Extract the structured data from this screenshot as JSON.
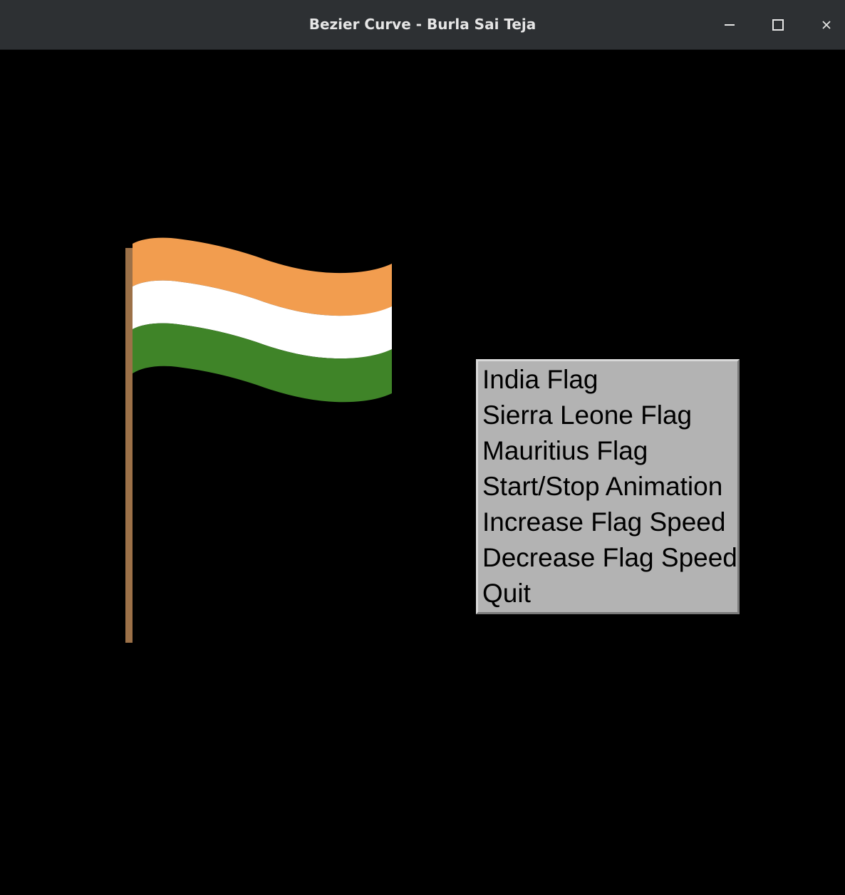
{
  "window": {
    "title": "Bezier Curve - Burla Sai Teja",
    "controls": {
      "minimize_icon": "minimize-icon",
      "maximize_icon": "maximize-icon",
      "close_icon": "close-icon"
    }
  },
  "scene": {
    "current_flag": "India",
    "pole_color": "#9c7148",
    "stripes": [
      {
        "color": "#f29d4f"
      },
      {
        "color": "#ffffff"
      },
      {
        "color": "#3f8428"
      }
    ]
  },
  "menu": {
    "items": [
      {
        "label": "India Flag"
      },
      {
        "label": "Sierra Leone Flag"
      },
      {
        "label": "Mauritius Flag"
      },
      {
        "label": "Start/Stop Animation"
      },
      {
        "label": "Increase Flag Speed"
      },
      {
        "label": "Decrease Flag Speed"
      },
      {
        "label": "Quit"
      }
    ]
  }
}
